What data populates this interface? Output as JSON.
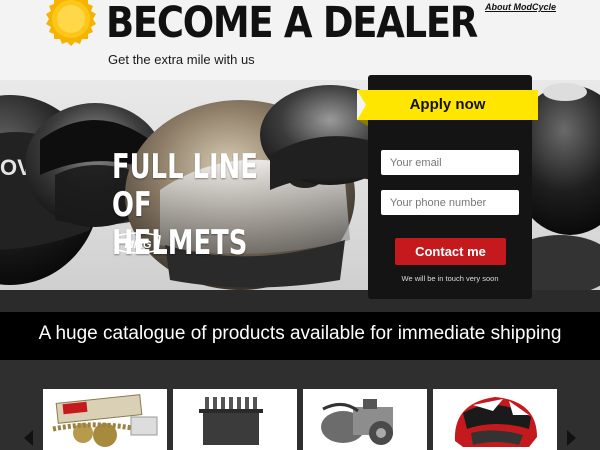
{
  "header": {
    "title": "BECOME A DEALER",
    "subtitle": "Get the extra mile with us",
    "about_link": "About ModCycle"
  },
  "hero": {
    "headline_line1": "FULL LINE OF",
    "headline_line2": "HELMETS",
    "brand_text": "MMG"
  },
  "form": {
    "apply_label": "Apply now",
    "email_placeholder": "Your email",
    "phone_placeholder": "Your phone number",
    "submit_label": "Contact me",
    "note": "We will be in touch very soon"
  },
  "catalogue": {
    "banner_text": "A huge catalogue of products available for immediate shipping"
  },
  "products": [
    {
      "icon": "chain-kit-icon"
    },
    {
      "icon": "regulator-icon"
    },
    {
      "icon": "engine-icon"
    },
    {
      "icon": "helmet-icon"
    }
  ],
  "colors": {
    "accent_yellow": "#ffe600",
    "cta_red": "#c51a1d",
    "panel_dark": "#141414"
  }
}
